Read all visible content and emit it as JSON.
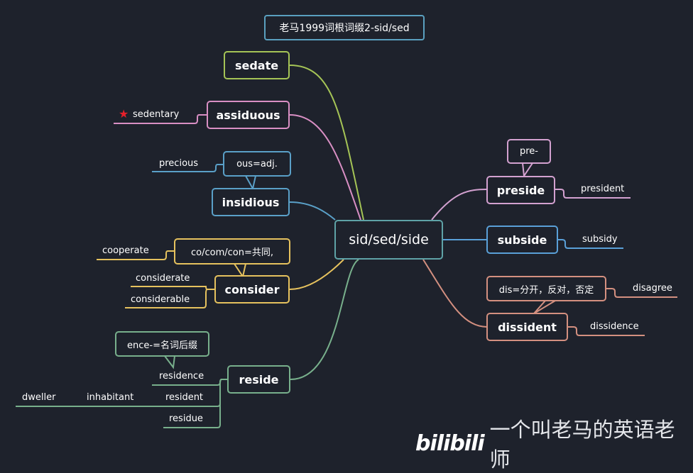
{
  "title": "老马1999词根词缀2-sid/sed",
  "center": "sid/sed/side",
  "colors": {
    "background": "#1e222c",
    "center": "#5fa3a7",
    "title": "#5aa0c0",
    "sedate": "#a5c456",
    "assiduous": "#d98fc4",
    "insidious": "#5aa0c8",
    "consider": "#e6c25e",
    "reside": "#78b08c",
    "preside": "#d3a1d0",
    "subside": "#5aa0d8",
    "dissident": "#d49080",
    "star": "#e8202a"
  },
  "left_branches": [
    {
      "word": "sedate",
      "notes": [],
      "leaves": []
    },
    {
      "word": "assiduous",
      "notes": [],
      "leaves": [
        {
          "text": "sedentary",
          "marker": "star-icon"
        }
      ]
    },
    {
      "word": "insidious",
      "notes": [
        "ous=adj."
      ],
      "leaves": [
        {
          "text": "precious"
        }
      ]
    },
    {
      "word": "consider",
      "notes": [
        "co/com/con=共同,"
      ],
      "leaves": [
        {
          "text": "cooperate"
        },
        {
          "text": "considerate"
        },
        {
          "text": "considerable"
        }
      ]
    },
    {
      "word": "reside",
      "notes": [
        "ence-=名词后缀"
      ],
      "leaves": [
        {
          "text": "residence"
        },
        {
          "text": "resident",
          "chain": [
            "inhabitant",
            "dweller"
          ]
        },
        {
          "text": "residue"
        }
      ]
    }
  ],
  "right_branches": [
    {
      "word": "preside",
      "notes": [
        "pre-"
      ],
      "leaves": [
        {
          "text": "president"
        }
      ]
    },
    {
      "word": "subside",
      "notes": [],
      "leaves": [
        {
          "text": "subsidy"
        }
      ]
    },
    {
      "word": "dissident",
      "notes": [
        "dis=分开，反对，否定"
      ],
      "leaves": [
        {
          "text": "disagree"
        },
        {
          "text": "dissidence"
        }
      ]
    }
  ],
  "watermark": {
    "logo": "bilibili",
    "text": "一个叫老马的英语老师"
  }
}
